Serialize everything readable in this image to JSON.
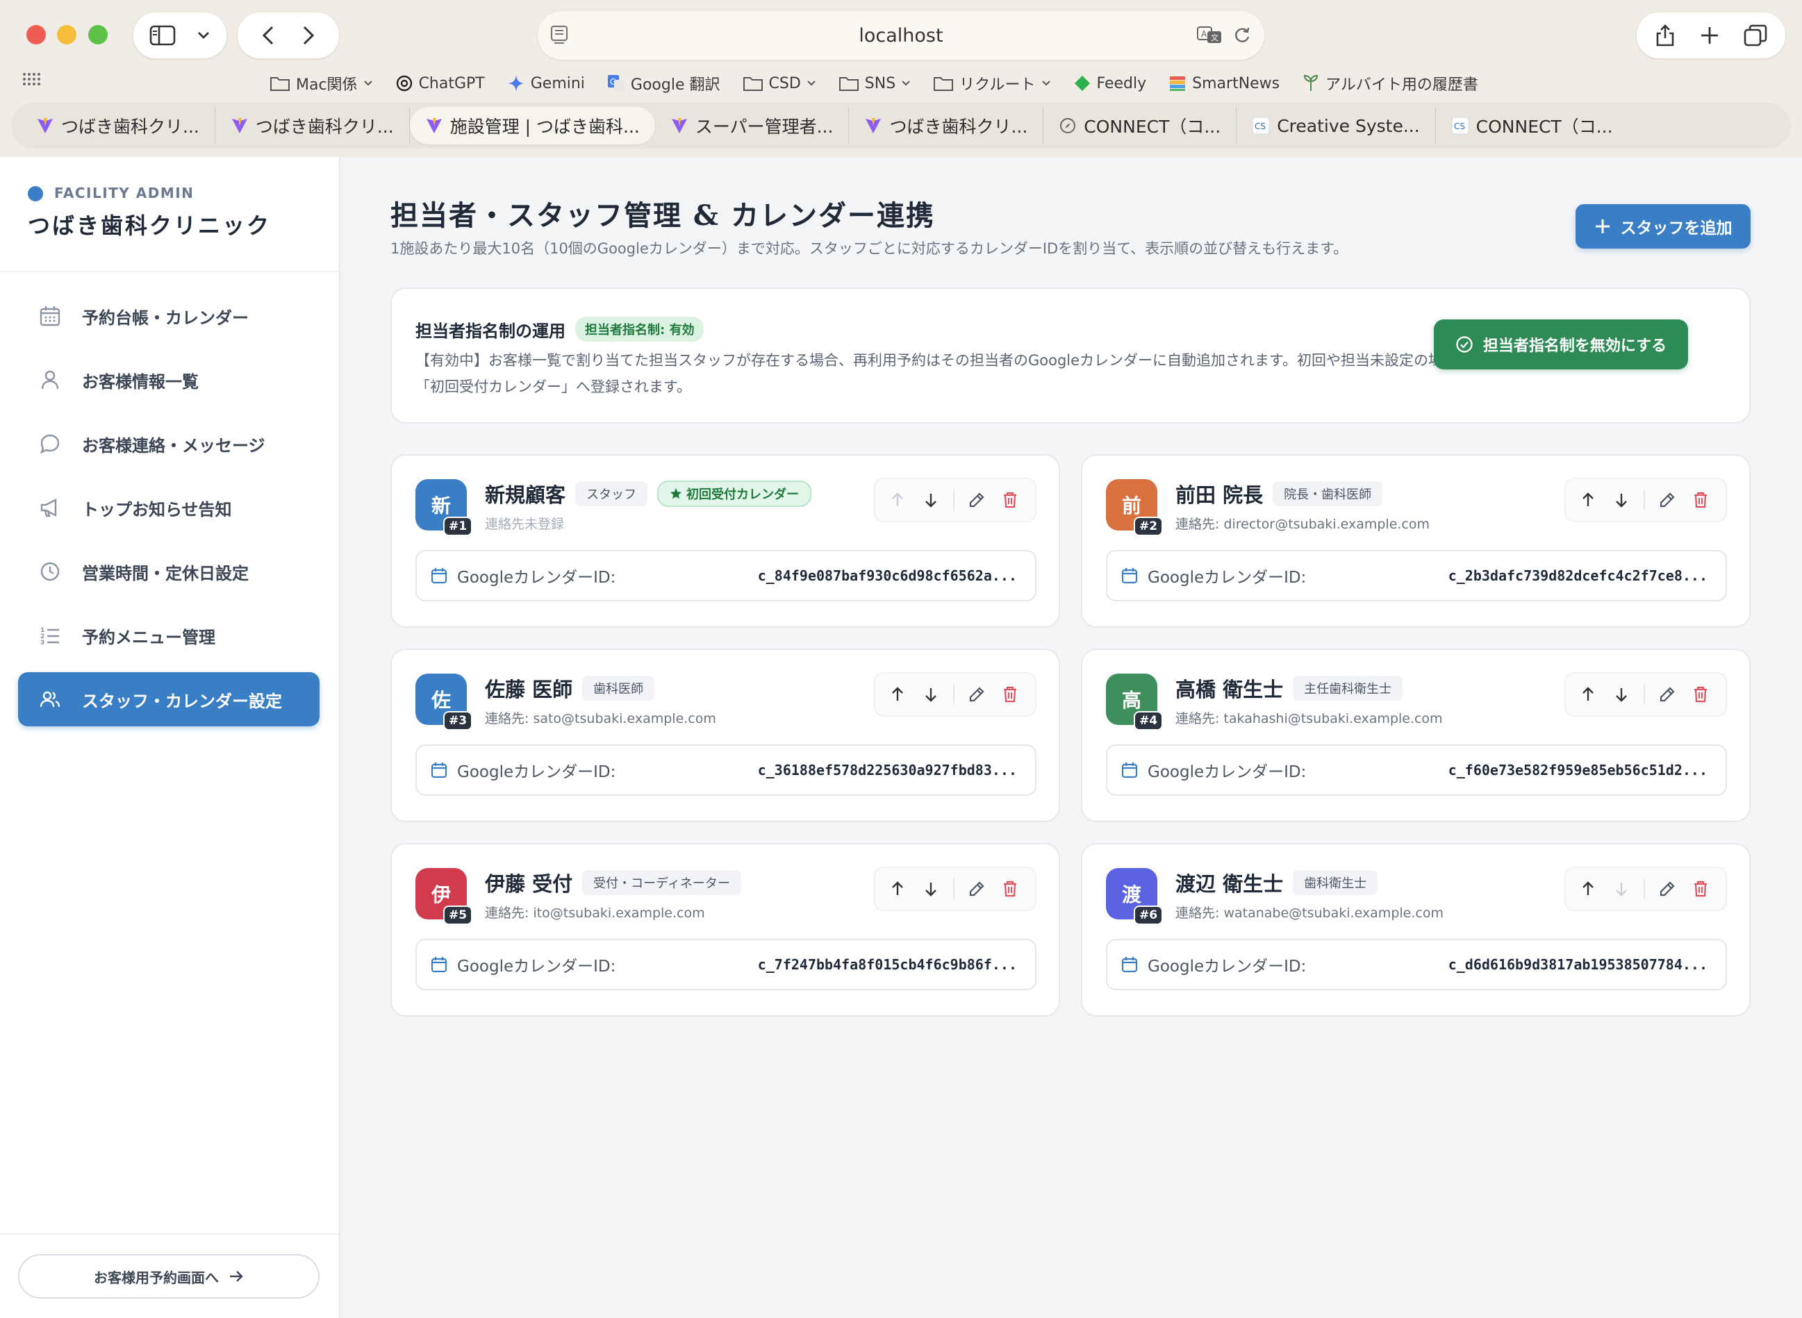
{
  "browser": {
    "url": "localhost",
    "bookmarks": [
      {
        "label": "Mac関係",
        "icon": "folder-icon",
        "dropdown": true
      },
      {
        "label": "ChatGPT",
        "icon": "chatgpt-icon",
        "dropdown": false
      },
      {
        "label": "Gemini",
        "icon": "gemini-icon",
        "dropdown": false
      },
      {
        "label": "Google 翻訳",
        "icon": "translate-icon",
        "dropdown": false
      },
      {
        "label": "CSD",
        "icon": "folder-icon",
        "dropdown": true
      },
      {
        "label": "SNS",
        "icon": "folder-icon",
        "dropdown": true
      },
      {
        "label": "リクルート",
        "icon": "folder-icon",
        "dropdown": true
      },
      {
        "label": "Feedly",
        "icon": "feedly-icon",
        "dropdown": false
      },
      {
        "label": "SmartNews",
        "icon": "smartnews-icon",
        "dropdown": false
      },
      {
        "label": "アルバイト用の履歴書",
        "icon": "leaf-icon",
        "dropdown": false
      }
    ],
    "tabs": [
      {
        "label": "つばき歯科クリ...",
        "icon": "vite-icon",
        "active": false
      },
      {
        "label": "つばき歯科クリ...",
        "icon": "vite-icon",
        "active": false
      },
      {
        "label": "施設管理 | つばき歯科...",
        "icon": "vite-icon",
        "active": true
      },
      {
        "label": "スーパー管理者...",
        "icon": "vite-icon",
        "active": false
      },
      {
        "label": "つばき歯科クリ...",
        "icon": "vite-icon",
        "active": false
      },
      {
        "label": "CONNECT（コ...",
        "icon": "compass-icon",
        "active": false
      },
      {
        "label": "Creative Syste...",
        "icon": "cs-logo-icon",
        "active": false
      },
      {
        "label": "CONNECT（コ...",
        "icon": "cs-logo-icon",
        "active": false
      }
    ]
  },
  "sidebar": {
    "tag": "FACILITY ADMIN",
    "clinic_name": "つばき歯科クリニック",
    "items": [
      {
        "label": "予約台帳・カレンダー",
        "icon": "calendar-icon",
        "active": false
      },
      {
        "label": "お客様情報一覧",
        "icon": "user-icon",
        "active": false
      },
      {
        "label": "お客様連絡・メッセージ",
        "icon": "chat-bubble-icon",
        "active": false
      },
      {
        "label": "トップお知らせ告知",
        "icon": "megaphone-icon",
        "active": false
      },
      {
        "label": "営業時間・定休日設定",
        "icon": "clock-icon",
        "active": false
      },
      {
        "label": "予約メニュー管理",
        "icon": "list-ordered-icon",
        "active": false
      },
      {
        "label": "スタッフ・カレンダー設定",
        "icon": "users-icon",
        "active": true
      }
    ],
    "public_link": "お客様用予約画面へ"
  },
  "main": {
    "title": "担当者・スタッフ管理 & カレンダー連携",
    "subtitle": "1施設あたり最大10名（10個のGoogleカレンダー）まで対応。スタッフごとに対応するカレンダーIDを割り当て、表示順の並び替えも行えます。",
    "add_button": "スタッフを追加",
    "policy": {
      "title": "担当者指名制の運用",
      "badge": "担当者指名制: 有効",
      "text": "【有効中】お客様一覧で割り当てた担当スタッフが存在する場合、再利用予約はその担当者のGoogleカレンダーに自動追加されます。初回や担当未設定の場合は「初回受付カレンダー」へ登録されます。",
      "button": "担当者指名制を無効にする"
    },
    "cal_label": "GoogleカレンダーID:",
    "staff": [
      {
        "initial": "新",
        "num": "#1",
        "name": "新規顧客",
        "role": "スタッフ",
        "first_badge": "初回受付カレンダー",
        "contact": "連絡先未登録",
        "contact_muted": true,
        "calendar_id": "c_84f9e087baf930c6d98cf6562a...",
        "color": "#3a7ec6",
        "up_enabled": false,
        "down_enabled": true
      },
      {
        "initial": "前",
        "num": "#2",
        "name": "前田 院長",
        "role": "院長・歯科医師",
        "first_badge": "",
        "contact": "連絡先: director@tsubaki.example.com",
        "contact_muted": false,
        "calendar_id": "c_2b3dafc739d82dcefc4c2f7ce8...",
        "color": "#d9703f",
        "up_enabled": true,
        "down_enabled": true
      },
      {
        "initial": "佐",
        "num": "#3",
        "name": "佐藤 医師",
        "role": "歯科医師",
        "first_badge": "",
        "contact": "連絡先: sato@tsubaki.example.com",
        "contact_muted": false,
        "calendar_id": "c_36188ef578d225630a927fbd83...",
        "color": "#3a7ec6",
        "up_enabled": true,
        "down_enabled": true
      },
      {
        "initial": "高",
        "num": "#4",
        "name": "高橋 衛生士",
        "role": "主任歯科衛生士",
        "first_badge": "",
        "contact": "連絡先: takahashi@tsubaki.example.com",
        "contact_muted": false,
        "calendar_id": "c_f60e73e582f959e85eb56c51d2...",
        "color": "#3f8f5c",
        "up_enabled": true,
        "down_enabled": true
      },
      {
        "initial": "伊",
        "num": "#5",
        "name": "伊藤 受付",
        "role": "受付・コーディネーター",
        "first_badge": "",
        "contact": "連絡先: ito@tsubaki.example.com",
        "contact_muted": false,
        "calendar_id": "c_7f247bb4fa8f015cb4f6c9b86f...",
        "color": "#d23a4e",
        "up_enabled": true,
        "down_enabled": true
      },
      {
        "initial": "渡",
        "num": "#6",
        "name": "渡辺 衛生士",
        "role": "歯科衛生士",
        "first_badge": "",
        "contact": "連絡先: watanabe@tsubaki.example.com",
        "contact_muted": false,
        "calendar_id": "c_d6d616b9d3817ab19538507784...",
        "color": "#5b63e0",
        "up_enabled": true,
        "down_enabled": false
      }
    ]
  },
  "colors": {
    "accent": "#3a7ec6",
    "success": "#2e8b55",
    "danger": "#e0525f"
  }
}
